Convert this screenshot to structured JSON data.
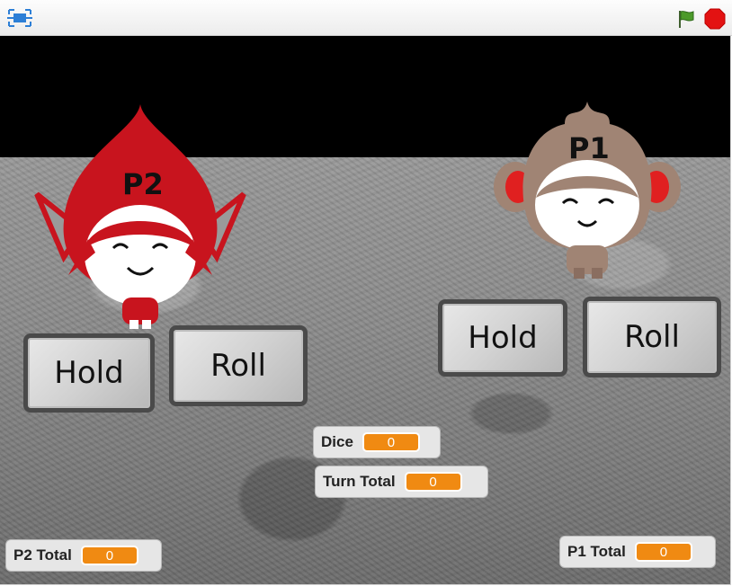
{
  "toolbar": {
    "stage_toggle_icon": "fullscreen-toggle-icon",
    "green_flag_icon": "green-flag-icon",
    "stop_icon": "stop-sign-icon",
    "colors": {
      "flag": "#3f7f2f",
      "stop": "#e31212"
    }
  },
  "sprites": {
    "p2": {
      "label": "P2",
      "color": "#c8141e"
    },
    "p1": {
      "label": "P1",
      "color": "#a08474"
    }
  },
  "buttons": {
    "p2_hold": "Hold",
    "p2_roll": "Roll",
    "p1_hold": "Hold",
    "p1_roll": "Roll"
  },
  "monitors": {
    "dice": {
      "label": "Dice",
      "value": "0"
    },
    "turn_total": {
      "label": "Turn Total",
      "value": "0"
    },
    "p2_total": {
      "label": "P2 Total",
      "value": "0"
    },
    "p1_total": {
      "label": "P1 Total",
      "value": "0"
    }
  }
}
